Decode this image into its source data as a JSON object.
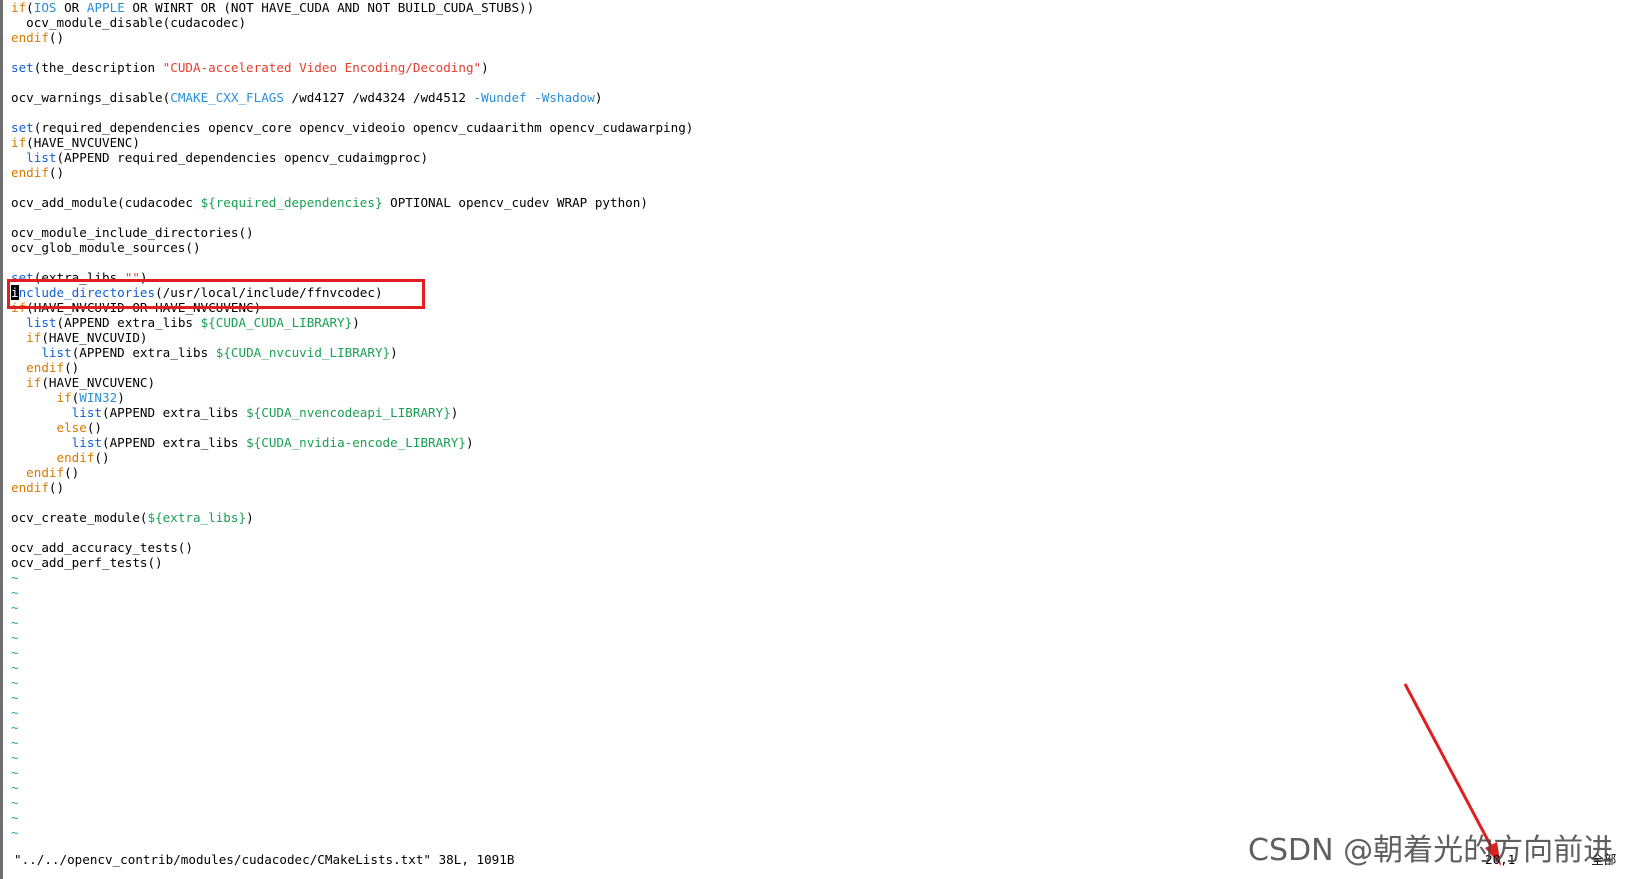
{
  "editor": {
    "lines": [
      [
        {
          "t": "if",
          "c": "kw"
        },
        {
          "t": "(",
          "c": "punc"
        },
        {
          "t": "IOS",
          "c": "cyan"
        },
        {
          "t": " OR ",
          "c": ""
        },
        {
          "t": "APPLE",
          "c": "cyan"
        },
        {
          "t": " OR WINRT OR (NOT HAVE_CUDA AND NOT BUILD_CUDA_STUBS))",
          "c": ""
        }
      ],
      [
        {
          "t": "  ocv_module_disable(cudacodec)",
          "c": ""
        }
      ],
      [
        {
          "t": "endif",
          "c": "kw"
        },
        {
          "t": "()",
          "c": "punc"
        }
      ],
      [
        {
          "t": "",
          "c": ""
        }
      ],
      [
        {
          "t": "set",
          "c": "fn"
        },
        {
          "t": "(the_description ",
          "c": ""
        },
        {
          "t": "\"CUDA-accelerated Video Encoding/Decoding\"",
          "c": "str"
        },
        {
          "t": ")",
          "c": ""
        }
      ],
      [
        {
          "t": "",
          "c": ""
        }
      ],
      [
        {
          "t": "ocv_warnings_disable(",
          "c": ""
        },
        {
          "t": "CMAKE_CXX_FLAGS",
          "c": "cyan"
        },
        {
          "t": " /wd4127 /wd4324 /wd4512 ",
          "c": ""
        },
        {
          "t": "-Wundef -Wshadow",
          "c": "cyan"
        },
        {
          "t": ")",
          "c": ""
        }
      ],
      [
        {
          "t": "",
          "c": ""
        }
      ],
      [
        {
          "t": "set",
          "c": "fn"
        },
        {
          "t": "(required_dependencies opencv_core opencv_videoio opencv_cudaarithm opencv_cudawarping)",
          "c": ""
        }
      ],
      [
        {
          "t": "if",
          "c": "kw"
        },
        {
          "t": "(HAVE_NVCUVENC)",
          "c": ""
        }
      ],
      [
        {
          "t": "  ",
          "c": ""
        },
        {
          "t": "list",
          "c": "fn"
        },
        {
          "t": "(APPEND required_dependencies opencv_cudaimgproc)",
          "c": ""
        }
      ],
      [
        {
          "t": "endif",
          "c": "kw"
        },
        {
          "t": "()",
          "c": "punc"
        }
      ],
      [
        {
          "t": "",
          "c": ""
        }
      ],
      [
        {
          "t": "ocv_add_module(cudacodec ",
          "c": ""
        },
        {
          "t": "${required_dependencies}",
          "c": "var"
        },
        {
          "t": " OPTIONAL opencv_cudev WRAP python)",
          "c": ""
        }
      ],
      [
        {
          "t": "",
          "c": ""
        }
      ],
      [
        {
          "t": "ocv_module_include_directories()",
          "c": ""
        }
      ],
      [
        {
          "t": "ocv_glob_module_sources()",
          "c": ""
        }
      ],
      [
        {
          "t": "",
          "c": ""
        }
      ],
      [
        {
          "t": "set",
          "c": "fn"
        },
        {
          "t": "(extra_libs ",
          "c": ""
        },
        {
          "t": "\"\"",
          "c": "str"
        },
        {
          "t": ")",
          "c": ""
        }
      ],
      [
        {
          "t": "i",
          "c": "cursor"
        },
        {
          "t": "nclude_directories",
          "c": "fn"
        },
        {
          "t": "(/usr/local/include/ffnvcodec)",
          "c": ""
        }
      ],
      [
        {
          "t": "if",
          "c": "kw"
        },
        {
          "t": "(HAVE_NVCUVID OR HAVE_NVCUVENC)",
          "c": ""
        }
      ],
      [
        {
          "t": "  ",
          "c": ""
        },
        {
          "t": "list",
          "c": "fn"
        },
        {
          "t": "(APPEND extra_libs ",
          "c": ""
        },
        {
          "t": "${CUDA_CUDA_LIBRARY}",
          "c": "var"
        },
        {
          "t": ")",
          "c": ""
        }
      ],
      [
        {
          "t": "  ",
          "c": ""
        },
        {
          "t": "if",
          "c": "kw"
        },
        {
          "t": "(HAVE_NVCUVID)",
          "c": ""
        }
      ],
      [
        {
          "t": "    ",
          "c": ""
        },
        {
          "t": "list",
          "c": "fn"
        },
        {
          "t": "(APPEND extra_libs ",
          "c": ""
        },
        {
          "t": "${CUDA_nvcuvid_LIBRARY}",
          "c": "var"
        },
        {
          "t": ")",
          "c": ""
        }
      ],
      [
        {
          "t": "  ",
          "c": ""
        },
        {
          "t": "endif",
          "c": "kw"
        },
        {
          "t": "()",
          "c": "punc"
        }
      ],
      [
        {
          "t": "  ",
          "c": ""
        },
        {
          "t": "if",
          "c": "kw"
        },
        {
          "t": "(HAVE_NVCUVENC)",
          "c": ""
        }
      ],
      [
        {
          "t": "      ",
          "c": ""
        },
        {
          "t": "if",
          "c": "kw"
        },
        {
          "t": "(",
          "c": ""
        },
        {
          "t": "WIN32",
          "c": "cyan"
        },
        {
          "t": ")",
          "c": ""
        }
      ],
      [
        {
          "t": "        ",
          "c": ""
        },
        {
          "t": "list",
          "c": "fn"
        },
        {
          "t": "(APPEND extra_libs ",
          "c": ""
        },
        {
          "t": "${CUDA_nvencodeapi_LIBRARY}",
          "c": "var"
        },
        {
          "t": ")",
          "c": ""
        }
      ],
      [
        {
          "t": "      ",
          "c": ""
        },
        {
          "t": "else",
          "c": "kw"
        },
        {
          "t": "()",
          "c": "punc"
        }
      ],
      [
        {
          "t": "        ",
          "c": ""
        },
        {
          "t": "list",
          "c": "fn"
        },
        {
          "t": "(APPEND extra_libs ",
          "c": ""
        },
        {
          "t": "${CUDA_nvidia-encode_LIBRARY}",
          "c": "var"
        },
        {
          "t": ")",
          "c": ""
        }
      ],
      [
        {
          "t": "      ",
          "c": ""
        },
        {
          "t": "endif",
          "c": "kw"
        },
        {
          "t": "()",
          "c": "punc"
        }
      ],
      [
        {
          "t": "  ",
          "c": ""
        },
        {
          "t": "endif",
          "c": "kw"
        },
        {
          "t": "()",
          "c": "punc"
        }
      ],
      [
        {
          "t": "endif",
          "c": "kw"
        },
        {
          "t": "()",
          "c": "punc"
        }
      ],
      [
        {
          "t": "",
          "c": ""
        }
      ],
      [
        {
          "t": "ocv_create_module(",
          "c": ""
        },
        {
          "t": "${extra_libs}",
          "c": "var"
        },
        {
          "t": ")",
          "c": ""
        }
      ],
      [
        {
          "t": "",
          "c": ""
        }
      ],
      [
        {
          "t": "ocv_add_accuracy_tests()",
          "c": ""
        }
      ],
      [
        {
          "t": "ocv_add_perf_tests()",
          "c": ""
        }
      ]
    ],
    "tilde_char": "~",
    "tilde_count": 18
  },
  "statusbar": {
    "file_info": "\"../../opencv_contrib/modules/cudacodec/CMakeLists.txt\" 38L, 1091B",
    "position": "20,1",
    "scroll": "全部"
  },
  "watermark": {
    "text": "CSDN @朝着光的方向前进"
  },
  "colors": {
    "keyword": "#d97a00",
    "function": "#1060d8",
    "string": "#e3402f",
    "variable": "#1aa055",
    "constant": "#2a8fd8",
    "tilde": "#2aa1b3",
    "annotation": "#e02020"
  }
}
